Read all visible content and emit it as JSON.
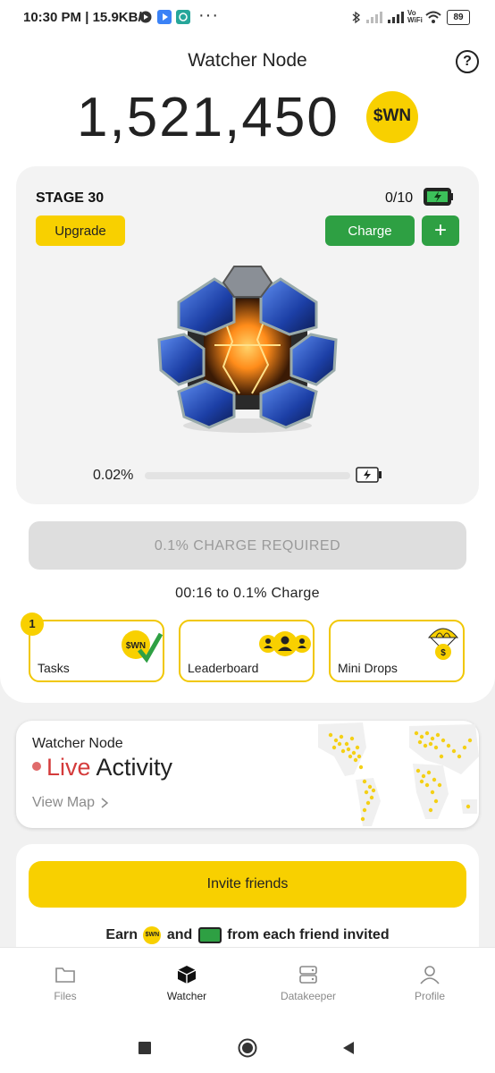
{
  "status_bar": {
    "time": "10:30 PM",
    "speed": "15.9KB/s",
    "battery": "89",
    "more": "···"
  },
  "header": {
    "title": "Watcher Node",
    "help_icon": "question-icon"
  },
  "balance": {
    "amount": "1,521,450",
    "token": "$WN"
  },
  "node_card": {
    "stage": "STAGE 30",
    "energy": "0/10",
    "upgrade_label": "Upgrade",
    "charge_label": "Charge",
    "plus_label": "+",
    "progress_text": "0.02%",
    "progress_fraction": 0.0002
  },
  "charge_required": "0.1% CHARGE REQUIRED",
  "timer": "00:16 to 0.1% Charge",
  "features": [
    {
      "label": "Tasks",
      "badge": "1"
    },
    {
      "label": "Leaderboard"
    },
    {
      "label": "Mini Drops"
    }
  ],
  "live": {
    "subtitle": "Watcher Node",
    "live_word": "Live",
    "activity_word": "Activity",
    "view_map": "View Map"
  },
  "invite": {
    "button": "Invite friends",
    "earn_pre": "Earn",
    "earn_and": "and",
    "earn_post": "from each friend invited",
    "coin_text": "$WN"
  },
  "nav": {
    "items": [
      {
        "label": "Files"
      },
      {
        "label": "Watcher"
      },
      {
        "label": "Datakeeper"
      },
      {
        "label": "Profile"
      }
    ]
  },
  "colors": {
    "accent_yellow": "#f8d000",
    "green": "#2ea043",
    "live_red": "#d43b3b"
  }
}
